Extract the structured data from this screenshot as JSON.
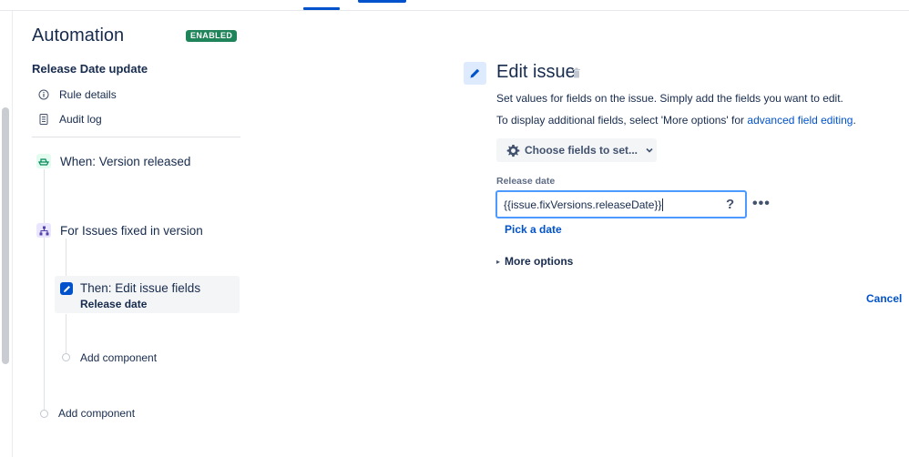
{
  "header": {
    "title": "Automation",
    "status_badge": "ENABLED"
  },
  "rule": {
    "name": "Release Date update",
    "nav": [
      {
        "label": "Rule details",
        "icon": "info-icon"
      },
      {
        "label": "Audit log",
        "icon": "document-icon"
      }
    ]
  },
  "flow": {
    "trigger": {
      "label": "When: Version released",
      "icon": "ship-icon"
    },
    "branch": {
      "label": "For Issues fixed in version",
      "icon": "hierarchy-icon"
    },
    "action": {
      "title": "Then: Edit issue fields",
      "subtitle": "Release date",
      "icon": "pencil-icon"
    },
    "add_component_inner": "Add component",
    "add_component_outer": "Add component"
  },
  "editor": {
    "title": "Edit issue",
    "description": "Set values for fields on the issue. Simply add the fields you want to edit.",
    "additional_prefix": "To display additional fields, select 'More options' for ",
    "additional_link": "advanced field editing",
    "additional_suffix": ".",
    "choose_fields_label": "Choose fields to set...",
    "field_label": "Release date",
    "field_value": "{{issue.fixVersions.releaseDate}}",
    "help_symbol": "?",
    "more_symbol": "•••",
    "pick_date_label": "Pick a date",
    "more_options_label": "More options",
    "cancel_label": "Cancel"
  },
  "colors": {
    "accent": "#0052cc",
    "badge_green": "#1f845a",
    "text": "#172b4d"
  }
}
